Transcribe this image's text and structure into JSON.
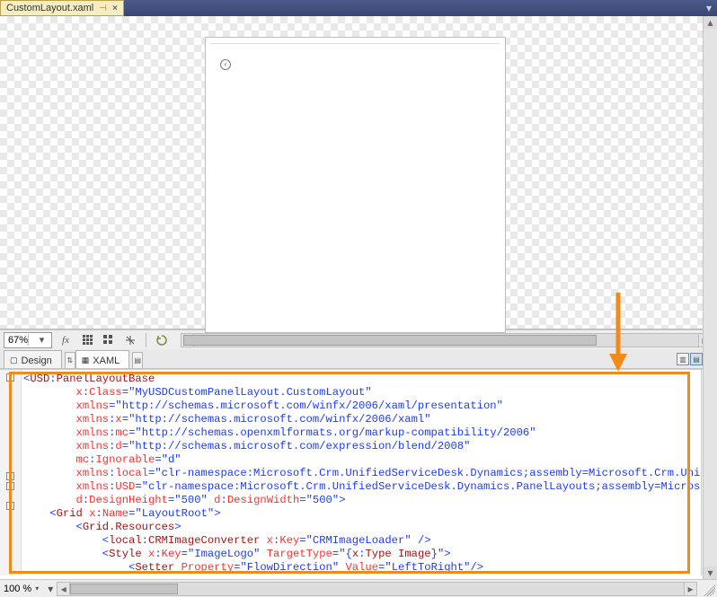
{
  "file_tab": {
    "name": "CustomLayout.xaml"
  },
  "toolrow": {
    "zoom": "67%"
  },
  "view_tabs": {
    "design": "Design",
    "xaml": "XAML"
  },
  "status": {
    "zoom": "100 %"
  },
  "code": {
    "lines": [
      [
        {
          "c": "punct",
          "t": "<"
        },
        {
          "c": "tag",
          "t": "USD"
        },
        {
          "c": "punct",
          "t": ":"
        },
        {
          "c": "tag",
          "t": "PanelLayoutBase"
        }
      ],
      [
        {
          "c": "",
          "t": "        "
        },
        {
          "c": "attr",
          "t": "x"
        },
        {
          "c": "punct",
          "t": ":"
        },
        {
          "c": "attr",
          "t": "Class"
        },
        {
          "c": "punct",
          "t": "="
        },
        {
          "c": "val",
          "t": "\"MyUSDCustomPanelLayout.CustomLayout\""
        }
      ],
      [
        {
          "c": "",
          "t": "        "
        },
        {
          "c": "attr",
          "t": "xmlns"
        },
        {
          "c": "punct",
          "t": "="
        },
        {
          "c": "val",
          "t": "\"http://schemas.microsoft.com/winfx/2006/xaml/presentation\""
        }
      ],
      [
        {
          "c": "",
          "t": "        "
        },
        {
          "c": "attr",
          "t": "xmlns"
        },
        {
          "c": "punct",
          "t": ":"
        },
        {
          "c": "attr",
          "t": "x"
        },
        {
          "c": "punct",
          "t": "="
        },
        {
          "c": "val",
          "t": "\"http://schemas.microsoft.com/winfx/2006/xaml\""
        }
      ],
      [
        {
          "c": "",
          "t": "        "
        },
        {
          "c": "attr",
          "t": "xmlns"
        },
        {
          "c": "punct",
          "t": ":"
        },
        {
          "c": "attr",
          "t": "mc"
        },
        {
          "c": "punct",
          "t": "="
        },
        {
          "c": "val",
          "t": "\"http://schemas.openxmlformats.org/markup-compatibility/2006\""
        }
      ],
      [
        {
          "c": "",
          "t": "        "
        },
        {
          "c": "attr",
          "t": "xmlns"
        },
        {
          "c": "punct",
          "t": ":"
        },
        {
          "c": "attr",
          "t": "d"
        },
        {
          "c": "punct",
          "t": "="
        },
        {
          "c": "val",
          "t": "\"http://schemas.microsoft.com/expression/blend/2008\""
        }
      ],
      [
        {
          "c": "",
          "t": "        "
        },
        {
          "c": "attr",
          "t": "mc"
        },
        {
          "c": "punct",
          "t": ":"
        },
        {
          "c": "attr",
          "t": "Ignorable"
        },
        {
          "c": "punct",
          "t": "="
        },
        {
          "c": "val",
          "t": "\"d\""
        }
      ],
      [
        {
          "c": "",
          "t": "        "
        },
        {
          "c": "attr",
          "t": "xmlns"
        },
        {
          "c": "punct",
          "t": ":"
        },
        {
          "c": "attr",
          "t": "local"
        },
        {
          "c": "punct",
          "t": "="
        },
        {
          "c": "val",
          "t": "\"clr-namespace:Microsoft.Crm.UnifiedServiceDesk.Dynamics;assembly=Microsoft.Crm.Unifi"
        }
      ],
      [
        {
          "c": "",
          "t": "        "
        },
        {
          "c": "attr",
          "t": "xmlns"
        },
        {
          "c": "punct",
          "t": ":"
        },
        {
          "c": "attr",
          "t": "USD"
        },
        {
          "c": "punct",
          "t": "="
        },
        {
          "c": "val",
          "t": "\"clr-namespace:Microsoft.Crm.UnifiedServiceDesk.Dynamics.PanelLayouts;assembly=Microsof"
        }
      ],
      [
        {
          "c": "",
          "t": "        "
        },
        {
          "c": "attr",
          "t": "d"
        },
        {
          "c": "punct",
          "t": ":"
        },
        {
          "c": "attr",
          "t": "DesignHeight"
        },
        {
          "c": "punct",
          "t": "="
        },
        {
          "c": "val",
          "t": "\"500\""
        },
        {
          "c": "",
          "t": " "
        },
        {
          "c": "attr",
          "t": "d"
        },
        {
          "c": "punct",
          "t": ":"
        },
        {
          "c": "attr",
          "t": "DesignWidth"
        },
        {
          "c": "punct",
          "t": "="
        },
        {
          "c": "val",
          "t": "\"500\""
        },
        {
          "c": "punct",
          "t": ">"
        }
      ],
      [
        {
          "c": "",
          "t": "    "
        },
        {
          "c": "punct",
          "t": "<"
        },
        {
          "c": "tag",
          "t": "Grid"
        },
        {
          "c": "",
          "t": " "
        },
        {
          "c": "attr",
          "t": "x"
        },
        {
          "c": "punct",
          "t": ":"
        },
        {
          "c": "attr",
          "t": "Name"
        },
        {
          "c": "punct",
          "t": "="
        },
        {
          "c": "val",
          "t": "\"LayoutRoot\""
        },
        {
          "c": "punct",
          "t": ">"
        }
      ],
      [
        {
          "c": "",
          "t": "        "
        },
        {
          "c": "punct",
          "t": "<"
        },
        {
          "c": "tag",
          "t": "Grid.Resources"
        },
        {
          "c": "punct",
          "t": ">"
        }
      ],
      [
        {
          "c": "",
          "t": "            "
        },
        {
          "c": "punct",
          "t": "<"
        },
        {
          "c": "tag",
          "t": "local"
        },
        {
          "c": "punct",
          "t": ":"
        },
        {
          "c": "tag",
          "t": "CRMImageConverter"
        },
        {
          "c": "",
          "t": " "
        },
        {
          "c": "attr",
          "t": "x"
        },
        {
          "c": "punct",
          "t": ":"
        },
        {
          "c": "attr",
          "t": "Key"
        },
        {
          "c": "punct",
          "t": "="
        },
        {
          "c": "val",
          "t": "\"CRMImageLoader\""
        },
        {
          "c": "",
          "t": " "
        },
        {
          "c": "punct",
          "t": "/>"
        }
      ],
      [
        {
          "c": "",
          "t": "            "
        },
        {
          "c": "punct",
          "t": "<"
        },
        {
          "c": "tag",
          "t": "Style"
        },
        {
          "c": "",
          "t": " "
        },
        {
          "c": "attr",
          "t": "x"
        },
        {
          "c": "punct",
          "t": ":"
        },
        {
          "c": "attr",
          "t": "Key"
        },
        {
          "c": "punct",
          "t": "="
        },
        {
          "c": "val",
          "t": "\"ImageLogo\""
        },
        {
          "c": "",
          "t": " "
        },
        {
          "c": "attr",
          "t": "TargetType"
        },
        {
          "c": "punct",
          "t": "="
        },
        {
          "c": "val",
          "t": "\"{"
        },
        {
          "c": "tag",
          "t": "x"
        },
        {
          "c": "punct",
          "t": ":"
        },
        {
          "c": "tag",
          "t": "Type Image"
        },
        {
          "c": "val",
          "t": "}\""
        },
        {
          "c": "punct",
          "t": ">"
        }
      ],
      [
        {
          "c": "",
          "t": "                "
        },
        {
          "c": "punct",
          "t": "<"
        },
        {
          "c": "tag",
          "t": "Setter"
        },
        {
          "c": "",
          "t": " "
        },
        {
          "c": "attr",
          "t": "Property"
        },
        {
          "c": "punct",
          "t": "="
        },
        {
          "c": "val",
          "t": "\"FlowDirection\""
        },
        {
          "c": "",
          "t": " "
        },
        {
          "c": "attr",
          "t": "Value"
        },
        {
          "c": "punct",
          "t": "="
        },
        {
          "c": "val",
          "t": "\"LeftToRight\""
        },
        {
          "c": "punct",
          "t": "/>"
        }
      ]
    ]
  }
}
